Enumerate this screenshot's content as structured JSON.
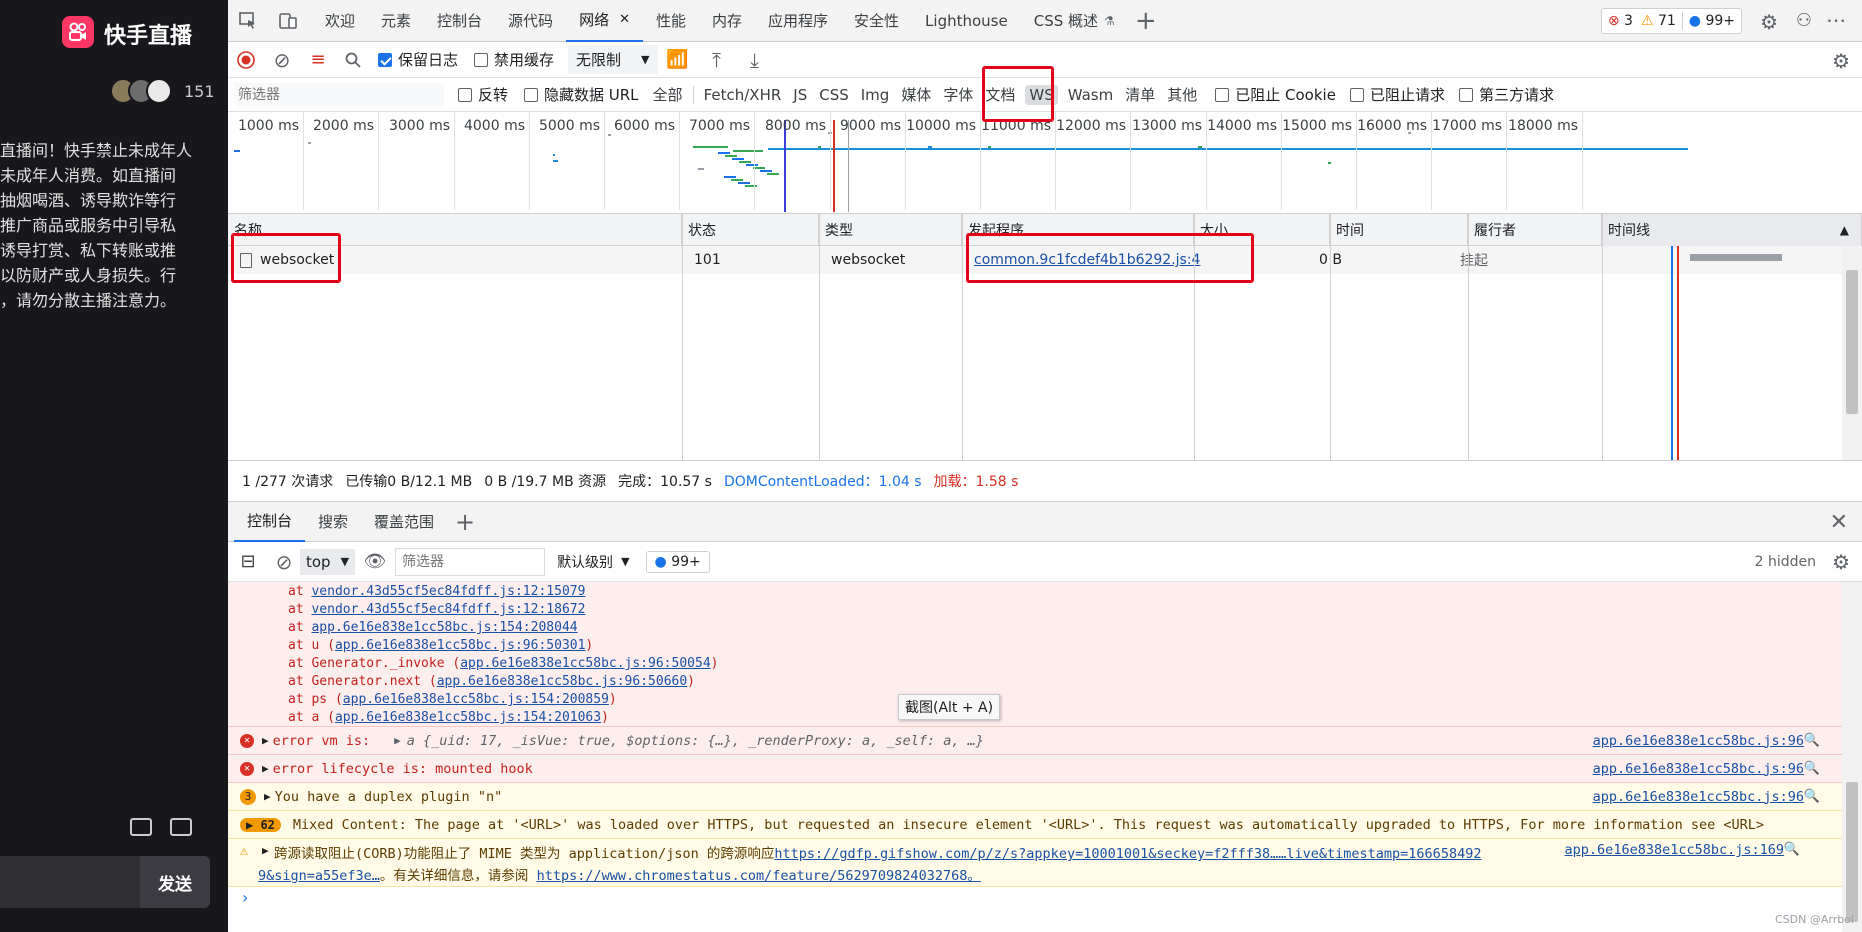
{
  "left": {
    "brand": "快手直播",
    "viewer_count": "151",
    "notice_lines": [
      "直播间！快手禁止未成年人",
      "未成年人消费。如直播间",
      "抽烟喝酒、诱导欺诈等行",
      "推广商品或服务中引导私",
      "诱导打赏、私下转账或推",
      "以防财产或人身损失。行",
      "，请勿分散主播注意力。"
    ],
    "send_label": "发送",
    "watermark": "CSDN @Arrbol"
  },
  "top_tabs": [
    "欢迎",
    "元素",
    "控制台",
    "源代码",
    "网络",
    "性能",
    "内存",
    "应用程序",
    "安全性",
    "Lighthouse",
    "CSS 概述"
  ],
  "active_tab": "网络",
  "badges": {
    "errors": "3",
    "warnings": "71",
    "info": "99+"
  },
  "toolbar": {
    "preserve_log": "保留日志",
    "disable_cache": "禁用缓存",
    "throttle": "无限制"
  },
  "filter": {
    "placeholder": "筛选器",
    "invert": "反转",
    "hide_data_urls": "隐藏数据 URL",
    "types": [
      "全部",
      "Fetch/XHR",
      "JS",
      "CSS",
      "Img",
      "媒体",
      "字体",
      "文档",
      "WS",
      "Wasm",
      "清单",
      "其他"
    ],
    "blocked_cookies": "已阻止 Cookie",
    "blocked_requests": "已阻止请求",
    "third_party": "第三方请求"
  },
  "overview_ticks": [
    "1000 ms",
    "2000 ms",
    "3000 ms",
    "4000 ms",
    "5000 ms",
    "6000 ms",
    "7000 ms",
    "8000 ms",
    "9000 ms",
    "10000 ms",
    "11000 ms",
    "12000 ms",
    "13000 ms",
    "14000 ms",
    "15000 ms",
    "16000 ms",
    "17000 ms",
    "18000 ms"
  ],
  "table": {
    "headers": [
      "名称",
      "状态",
      "类型",
      "发起程序",
      "大小",
      "时间",
      "履行者",
      "时间线"
    ],
    "row": {
      "name": "websocket",
      "status": "101",
      "type": "websocket",
      "initiator": "common.9c1fcdef4b1b6292.js:4",
      "size": "0 B",
      "time": "挂起"
    }
  },
  "summary": {
    "requests": "1 /277 次请求",
    "transferred": "已传输0 B/12.1 MB",
    "resources": "0 B /19.7 MB 资源",
    "finish": "完成：10.57 s",
    "dcl": "DOMContentLoaded：1.04 s",
    "load": "加载：1.58 s"
  },
  "drawer_tabs": [
    "控制台",
    "搜索",
    "覆盖范围"
  ],
  "console_toolbar": {
    "context": "top",
    "filter_placeholder": "筛选器",
    "levels": "默认级别",
    "issues": "99+",
    "hidden": "2 hidden"
  },
  "stack_lines": [
    {
      "pre": "at ",
      "link": "vendor.43d55cf5ec84fdff.js:12:15079",
      "post": ""
    },
    {
      "pre": "at ",
      "link": "vendor.43d55cf5ec84fdff.js:12:18672",
      "post": ""
    },
    {
      "pre": "at ",
      "link": "app.6e16e838e1cc58bc.js:154:208044",
      "post": ""
    },
    {
      "pre": "at u (",
      "link": "app.6e16e838e1cc58bc.js:96:50301",
      "post": ")"
    },
    {
      "pre": "at Generator._invoke (",
      "link": "app.6e16e838e1cc58bc.js:96:50054",
      "post": ")"
    },
    {
      "pre": "at Generator.next (",
      "link": "app.6e16e838e1cc58bc.js:96:50660",
      "post": ")"
    },
    {
      "pre": "at ps (",
      "link": "app.6e16e838e1cc58bc.js:154:200859",
      "post": ")"
    },
    {
      "pre": "at a (",
      "link": "app.6e16e838e1cc58bc.js:154:201063",
      "post": ")"
    }
  ],
  "tooltip": "截图(Alt + A)",
  "messages": {
    "err1_text": "error vm is:",
    "err1_obj": "a {_uid: 17, _isVue: true, $options: {…}, _renderProxy: a, _self: a, …}",
    "err2_text": "error lifecycle is:  mounted hook",
    "warn_count": "3",
    "warn_text": "You have a duplex plugin \"n\"",
    "src": "app.6e16e838e1cc58bc.js:96",
    "mixed_count": "62",
    "mixed_text": "Mixed Content: The page at '<URL>' was loaded over HTTPS, but requested an insecure element '<URL>'. This request was automatically upgraded to HTTPS, For more information see <URL>",
    "corb_text": "跨源读取阻止(CORB)功能阻止了 MIME 类型为 application/json 的跨源响应",
    "corb_link": "https://gdfp.gifshow.com/p/z/s?appkey=10001001&seckey=f2fff38……live&timestamp=166658492",
    "corb_src": "app.6e16e838e1cc58bc.js:169",
    "corb_line2_link1": "9&sign=a55ef3e…",
    "corb_line2_text": "。有关详细信息，请参阅",
    "corb_line2_link2": "https://www.chromestatus.com/feature/5629709824032768。"
  },
  "colors": {
    "accent": "#1a73e8",
    "error_bg": "#fdeeee",
    "warn_bg": "#fffbe6",
    "highlight": "#e3001b"
  }
}
